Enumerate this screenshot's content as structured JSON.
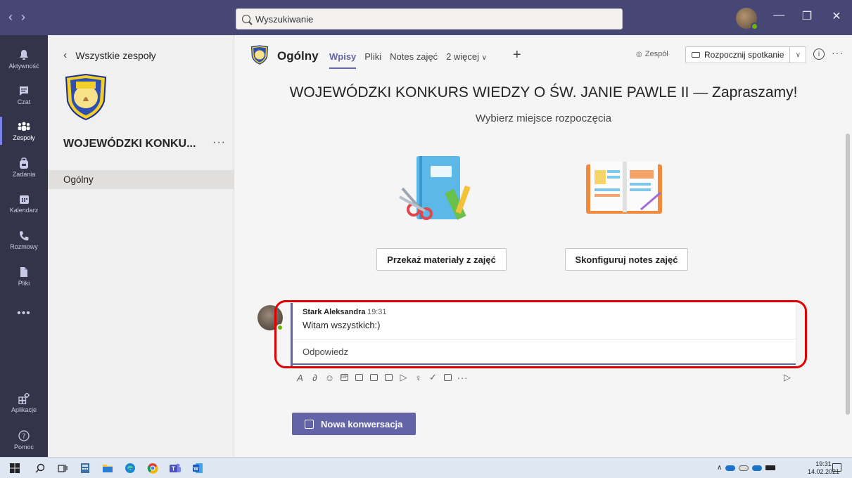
{
  "search": {
    "placeholder": "Wyszukiwanie"
  },
  "window": {
    "minimize": "—",
    "restore": "❐",
    "close": "✕"
  },
  "rail": [
    {
      "key": "activity",
      "label": "Aktywność"
    },
    {
      "key": "chat",
      "label": "Czat"
    },
    {
      "key": "teams",
      "label": "Zespoły",
      "active": true
    },
    {
      "key": "assignments",
      "label": "Zadania"
    },
    {
      "key": "calendar",
      "label": "Kalendarz"
    },
    {
      "key": "calls",
      "label": "Rozmowy"
    },
    {
      "key": "files",
      "label": "Pliki"
    },
    {
      "key": "apps",
      "label": "Aplikacje"
    },
    {
      "key": "help",
      "label": "Pomoc"
    }
  ],
  "pane": {
    "back_label": "Wszystkie zespoły",
    "team_name": "WOJEWÓDZKI KONKU...",
    "channel": "Ogólny"
  },
  "header": {
    "channel_title": "Ogólny",
    "tabs": [
      "Wpisy",
      "Pliki",
      "Notes zajęć",
      "2 więcej"
    ],
    "team_button": "Zespół",
    "meet_button": "Rozpocznij spotkanie"
  },
  "welcome": {
    "title": "WOJEWÓDZKI KONKURS WIEDZY O ŚW. JANIE PAWLE II — Zapraszamy!",
    "subtitle": "Wybierz miejsce rozpoczęcia",
    "button_materials": "Przekaż materiały z zajęć",
    "button_notebook": "Skonfiguruj notes zajęć"
  },
  "message": {
    "author": "Stark Aleksandra",
    "time": "19:31",
    "text": "Witam wszystkich:)",
    "reply_label": "Odpowiedz"
  },
  "new_conversation": "Nowa konwersacja",
  "taskbar": {
    "time": "19:31",
    "date": "14.02.2021"
  },
  "colors": {
    "accent": "#6264a7",
    "titlebar": "#464775",
    "rail": "#33344a",
    "highlight": "#e00000"
  }
}
